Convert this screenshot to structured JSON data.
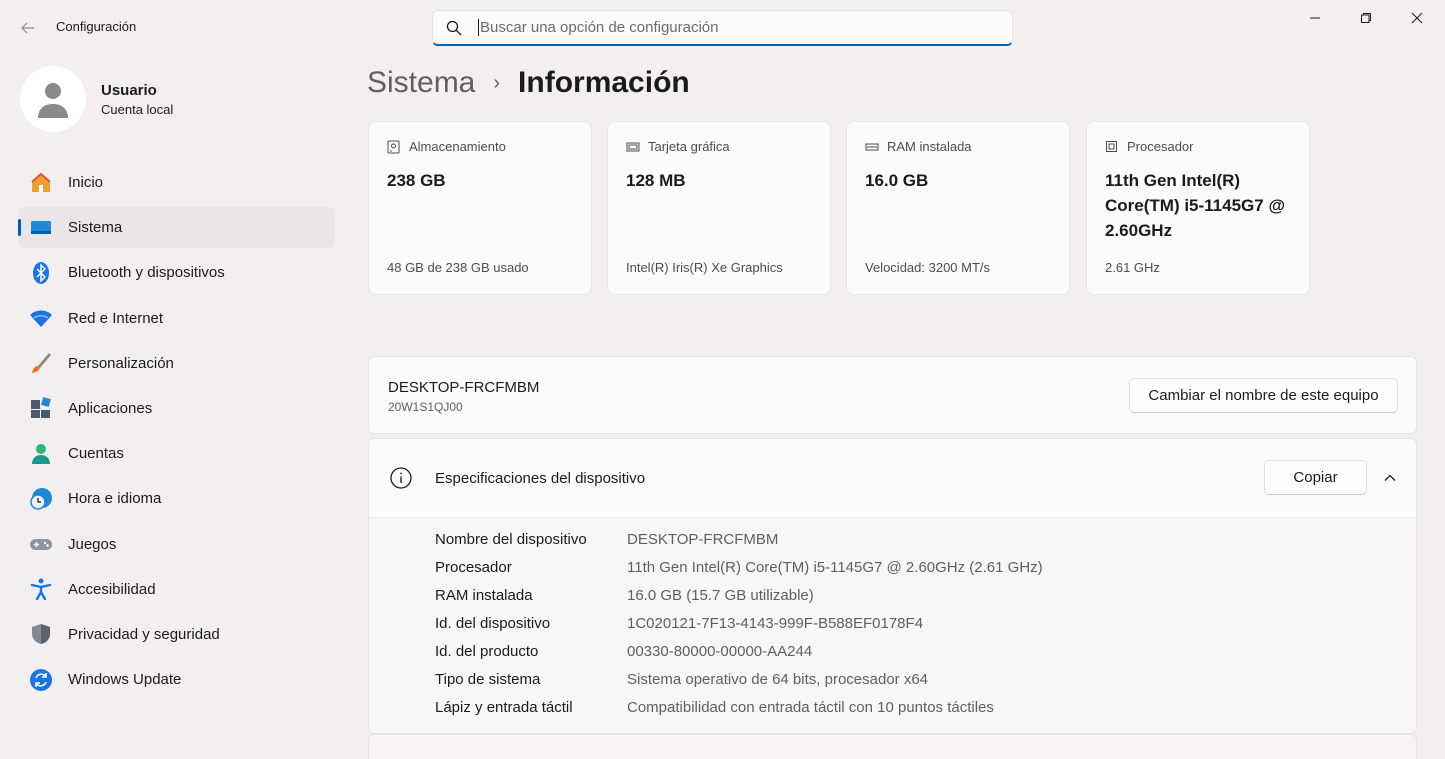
{
  "window": {
    "title": "Configuración",
    "back_icon": "back-arrow-icon",
    "controls": [
      "minimize-icon",
      "maximize-icon",
      "close-icon"
    ]
  },
  "search": {
    "placeholder": "Buscar una opción de configuración",
    "value": ""
  },
  "user": {
    "name": "Usuario",
    "account_type": "Cuenta local"
  },
  "sidebar": {
    "items": [
      {
        "label": "Inicio",
        "icon": "home-icon",
        "active": false
      },
      {
        "label": "Sistema",
        "icon": "system-icon",
        "active": true
      },
      {
        "label": "Bluetooth y dispositivos",
        "icon": "bluetooth-icon",
        "active": false
      },
      {
        "label": "Red e Internet",
        "icon": "wifi-icon",
        "active": false
      },
      {
        "label": "Personalización",
        "icon": "brush-icon",
        "active": false
      },
      {
        "label": "Aplicaciones",
        "icon": "apps-icon",
        "active": false
      },
      {
        "label": "Cuentas",
        "icon": "accounts-icon",
        "active": false
      },
      {
        "label": "Hora e idioma",
        "icon": "time-language-icon",
        "active": false
      },
      {
        "label": "Juegos",
        "icon": "gamepad-icon",
        "active": false
      },
      {
        "label": "Accesibilidad",
        "icon": "accessibility-icon",
        "active": false
      },
      {
        "label": "Privacidad y seguridad",
        "icon": "shield-icon",
        "active": false
      },
      {
        "label": "Windows Update",
        "icon": "update-icon",
        "active": false
      }
    ]
  },
  "breadcrumb": {
    "parent": "Sistema",
    "separator": "›",
    "current": "Información"
  },
  "cards": [
    {
      "title": "Almacenamiento",
      "icon": "storage-icon",
      "value": "238 GB",
      "footer": "48 GB de 238 GB usado"
    },
    {
      "title": "Tarjeta gráfica",
      "icon": "gpu-icon",
      "value": "128 MB",
      "footer": "Intel(R) Iris(R) Xe Graphics"
    },
    {
      "title": "RAM instalada",
      "icon": "ram-icon",
      "value": "16.0 GB",
      "footer": "Velocidad: 3200 MT/s"
    },
    {
      "title": "Procesador",
      "icon": "cpu-icon",
      "value": "11th Gen Intel(R) Core(TM) i5-1145G7 @ 2.60GHz",
      "footer": "2.61 GHz"
    }
  ],
  "pc": {
    "name": "DESKTOP-FRCFMBM",
    "model": "20W1S1QJ00",
    "rename_label": "Cambiar el nombre de este equipo"
  },
  "specs": {
    "title": "Especificaciones del dispositivo",
    "copy_label": "Copiar",
    "rows": [
      {
        "label": "Nombre del dispositivo",
        "value": "DESKTOP-FRCFMBM"
      },
      {
        "label": "Procesador",
        "value": "11th Gen Intel(R) Core(TM) i5-1145G7 @ 2.60GHz (2.61 GHz)"
      },
      {
        "label": "RAM instalada",
        "value": "16.0 GB (15.7 GB utilizable)"
      },
      {
        "label": "Id. del dispositivo",
        "value": "1C020121-7F13-4143-999F-B588EF0178F4"
      },
      {
        "label": "Id. del producto",
        "value": "00330-80000-00000-AA244"
      },
      {
        "label": "Tipo de sistema",
        "value": "Sistema operativo de 64 bits, procesador x64"
      },
      {
        "label": "Lápiz y entrada táctil",
        "value": "Compatibilidad con entrada táctil con 10 puntos táctiles"
      }
    ]
  },
  "colors": {
    "accent": "#005fb8",
    "background": "#f3eff0",
    "card": "#fbfbfb"
  }
}
